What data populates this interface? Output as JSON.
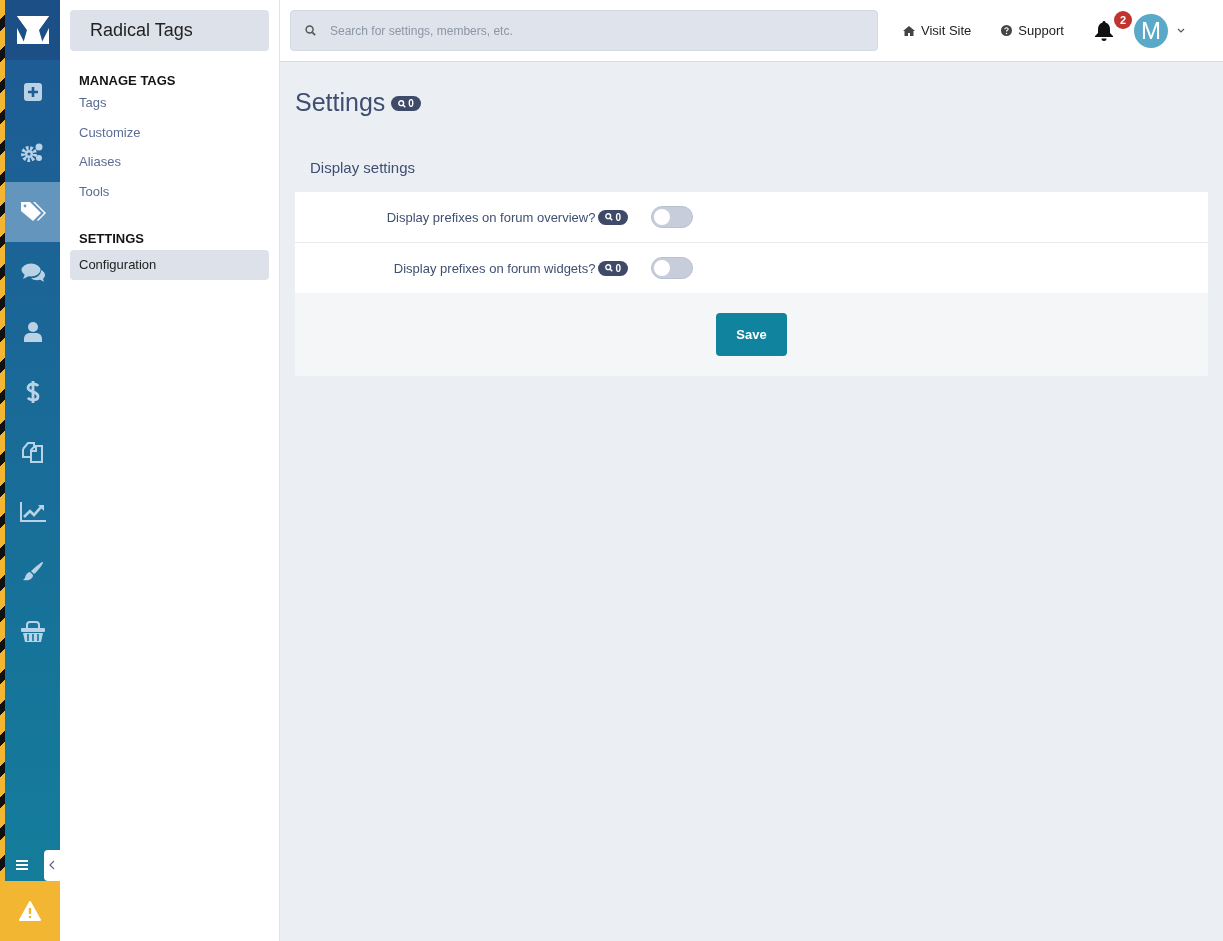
{
  "rail": {
    "items": [
      {
        "kind": "plus",
        "selected": false
      },
      {
        "kind": "gears",
        "selected": false
      },
      {
        "kind": "tags",
        "selected": true
      },
      {
        "kind": "chat",
        "selected": false
      },
      {
        "kind": "user",
        "selected": false
      },
      {
        "kind": "dollar",
        "selected": false
      },
      {
        "kind": "copy",
        "selected": false
      },
      {
        "kind": "chart",
        "selected": false
      },
      {
        "kind": "brush",
        "selected": false
      },
      {
        "kind": "basket",
        "selected": false
      }
    ]
  },
  "sidebar": {
    "title": "Radical Tags",
    "sections": [
      {
        "heading": "MANAGE TAGS",
        "items": [
          {
            "label": "Tags",
            "selected": false
          },
          {
            "label": "Customize",
            "selected": false
          },
          {
            "label": "Aliases",
            "selected": false
          },
          {
            "label": "Tools",
            "selected": false
          }
        ]
      },
      {
        "heading": "SETTINGS",
        "items": [
          {
            "label": "Configuration",
            "selected": true
          }
        ]
      }
    ]
  },
  "topbar": {
    "search": {
      "placeholder": "Search for settings, members, etc."
    },
    "links": [
      {
        "kind": "home",
        "label": "Visit Site"
      },
      {
        "kind": "help",
        "label": "Support"
      }
    ],
    "notifications": "2",
    "avatar": "M"
  },
  "page": {
    "title": "Settings",
    "title_count": "0",
    "section": "Display settings",
    "options": [
      {
        "label": "Display prefixes on forum overview?",
        "count": "0",
        "on": false
      },
      {
        "label": "Display prefixes on forum widgets?",
        "count": "0",
        "on": false
      }
    ],
    "save": "Save"
  }
}
